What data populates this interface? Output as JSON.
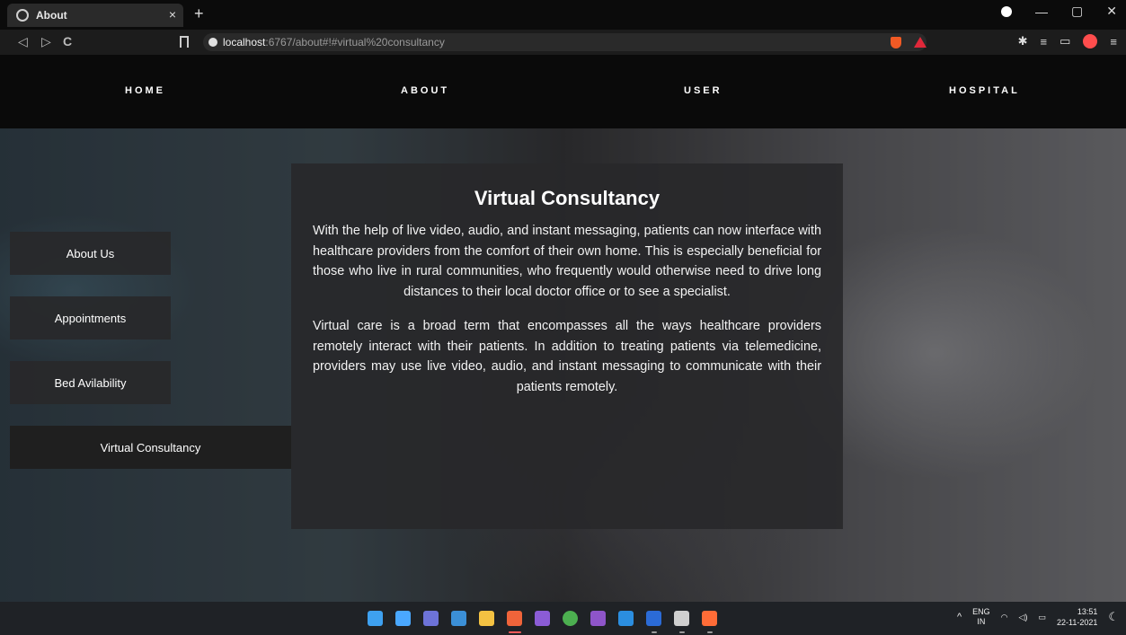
{
  "browser": {
    "tab_title": "About",
    "tab_close": "×",
    "new_tab": "+",
    "url_host": "localhost",
    "url_rest": ":6767/about#!#virtual%20consultancy",
    "window_controls": [
      "—",
      "▢",
      "✕"
    ],
    "nav": {
      "back": "◁",
      "forward": "▷",
      "reload": "C"
    },
    "extensions": [
      "✱",
      "≡",
      "▭"
    ]
  },
  "topnav": {
    "items": [
      "HOME",
      "ABOUT",
      "USER",
      "HOSPITAL"
    ]
  },
  "sidebar": {
    "items": [
      {
        "label": "About Us"
      },
      {
        "label": "Appointments"
      },
      {
        "label": "Bed Avilability"
      },
      {
        "label": "Virtual Consultancy"
      }
    ],
    "active_index": 3
  },
  "content": {
    "title": "Virtual Consultancy",
    "paragraphs": [
      "With the help of live video, audio, and instant messaging, patients can now interface with healthcare providers from the comfort of their own home. This is especially beneficial for those who live in rural communities, who frequently would otherwise need to drive long distances to their local doctor office or to see a specialist.",
      "Virtual care is a broad term that encompasses all the ways healthcare providers remotely interact with their patients. In addition to treating patients via telemedicine, providers may use live video, audio, and instant messaging to communicate with their patients remotely."
    ]
  },
  "taskbar": {
    "apps": [
      {
        "name": "windows-start",
        "color": "#3ea1f0"
      },
      {
        "name": "task-view",
        "color": "#4aa8ff"
      },
      {
        "name": "teams-chat",
        "color": "#6d73d8"
      },
      {
        "name": "widgets",
        "color": "#3b8fd6"
      },
      {
        "name": "file-explorer",
        "color": "#f4c242"
      },
      {
        "name": "brave-browser",
        "color": "#f0643a"
      },
      {
        "name": "intellij",
        "color": "#8b5cd6"
      },
      {
        "name": "chrome",
        "color": "#4caf50"
      },
      {
        "name": "visual-studio",
        "color": "#8e55c9"
      },
      {
        "name": "vs-code",
        "color": "#2b8ee0"
      },
      {
        "name": "word",
        "color": "#2b6bd6"
      },
      {
        "name": "terminal",
        "color": "#cfcfcf"
      },
      {
        "name": "postman",
        "color": "#ff6c37"
      }
    ],
    "tray": {
      "lang_top": "ENG",
      "lang_bottom": "IN",
      "time": "13:51",
      "date": "22-11-2021"
    }
  }
}
